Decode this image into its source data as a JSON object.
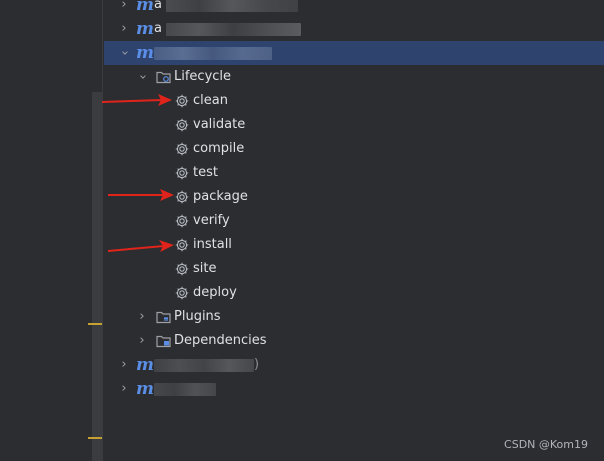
{
  "tree": {
    "projects": [
      {
        "initial": "m",
        "suffix": "a",
        "expanded": false
      },
      {
        "initial": "m",
        "suffix": "a",
        "expanded": false
      },
      {
        "initial": "m",
        "suffix": "",
        "expanded": true,
        "selected": true
      },
      {
        "initial": "m",
        "suffix": ")",
        "expanded": false
      },
      {
        "initial": "m",
        "suffix": "",
        "expanded": false
      }
    ],
    "lifecycle": {
      "label": "Lifecycle",
      "goals": [
        "clean",
        "validate",
        "compile",
        "test",
        "package",
        "verify",
        "install",
        "site",
        "deploy"
      ]
    },
    "plugins_label": "Plugins",
    "dependencies_label": "Dependencies"
  },
  "annotations": {
    "arrow_color": "#e0241b",
    "highlighted_goals": [
      "clean",
      "package",
      "install"
    ]
  },
  "watermark": "CSDN @Kom19",
  "colors": {
    "background": "#2b2d30",
    "selection": "#2e436e",
    "maven_icon": "#5b8ee6",
    "text": "#dfe1e5"
  }
}
